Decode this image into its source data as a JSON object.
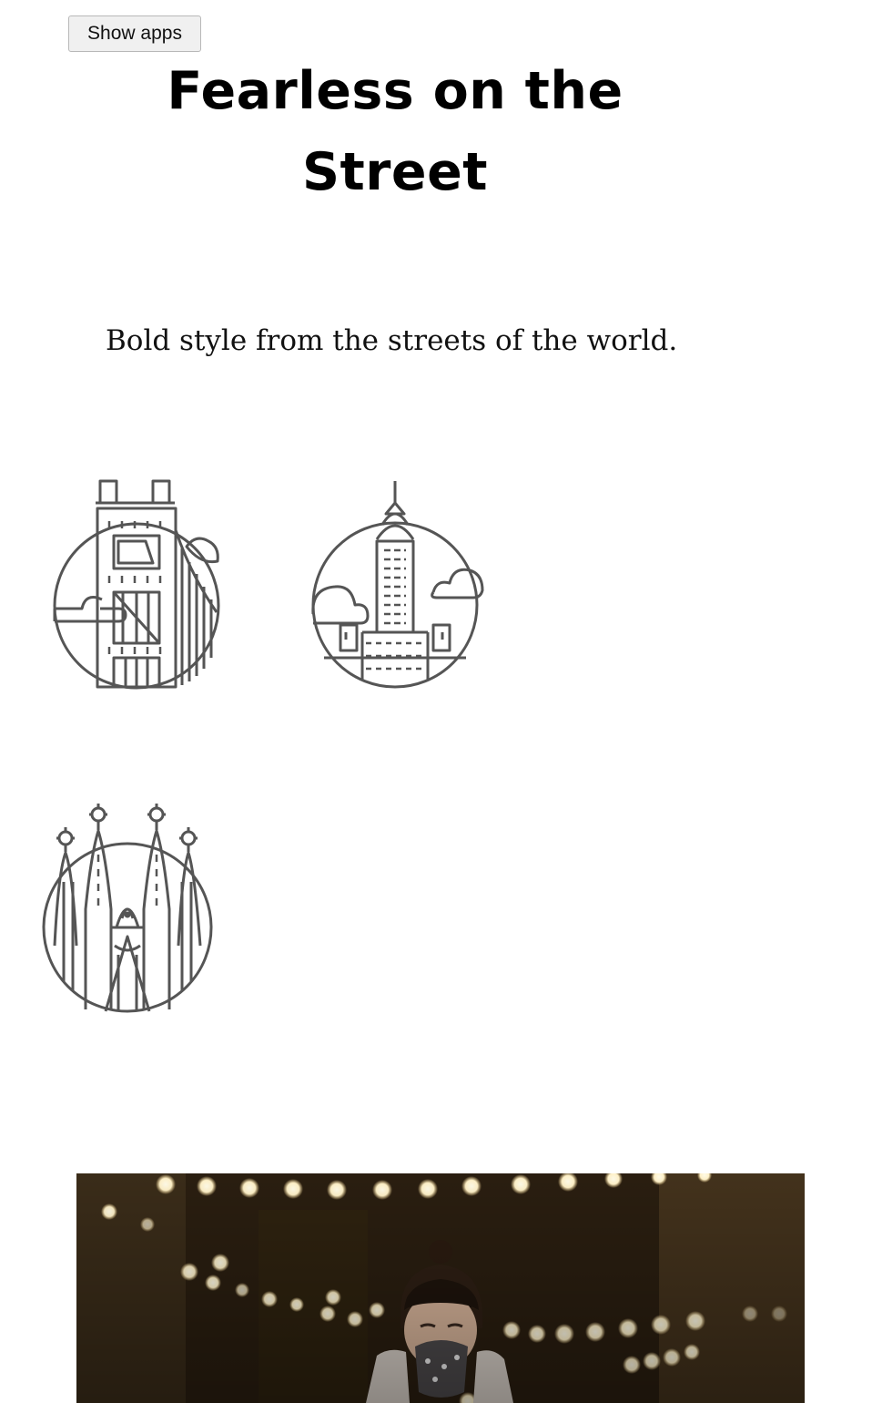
{
  "toolbar": {
    "show_apps_label": "Show apps"
  },
  "article": {
    "title": "Fearless on the Street",
    "subtitle": "Bold style from the streets of the world."
  },
  "icons": [
    {
      "name": "tower-bridge-icon"
    },
    {
      "name": "chrysler-building-icon"
    },
    {
      "name": "sagrada-familia-icon"
    }
  ],
  "colors": {
    "icon_stroke": "#555555",
    "photo_dark": "#1d150b",
    "bokeh_light": "#fff6df"
  }
}
